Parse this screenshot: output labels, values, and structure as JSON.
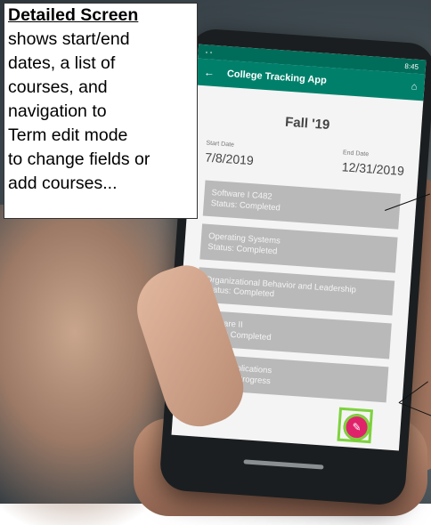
{
  "callout": {
    "heading": "Detailed Screen",
    "lines": [
      "shows start/end",
      "dates, a list of",
      "courses, and",
      "navigation to",
      "Term edit mode",
      "to change fields or",
      "add courses..."
    ]
  },
  "app": {
    "title": "College Tracking App",
    "status_time": "8:45",
    "term_title": "Fall '19",
    "start_label": "Start Date",
    "start_value": "7/8/2019",
    "end_label": "End Date",
    "end_value": "12/31/2019",
    "courses": [
      {
        "name": "Software I C482",
        "status": "Status: Completed"
      },
      {
        "name": "Operating Systems",
        "status": "Status: Completed"
      },
      {
        "name": "Organizational Behavior and Leadership",
        "status": "Status: Completed"
      },
      {
        "name": "Software II",
        "status": "Status: Completed"
      },
      {
        "name": "Mobile Applications",
        "status": "Status: In Progress"
      }
    ],
    "fab_icon": "pencil-icon",
    "accent_color": "#00806b",
    "fab_color": "#e0226b"
  }
}
